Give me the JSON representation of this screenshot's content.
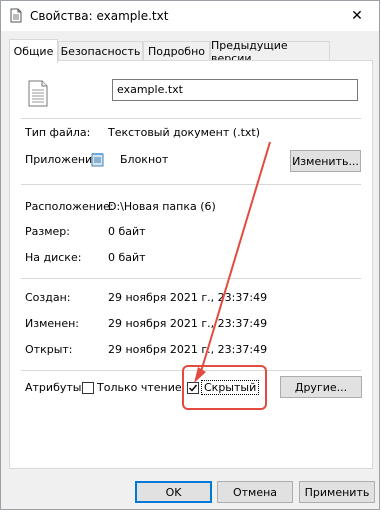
{
  "window": {
    "title": "Свойства: example.txt",
    "close_glyph": "✕"
  },
  "tabs": [
    {
      "label": "Общие",
      "active": true
    },
    {
      "label": "Безопасность",
      "active": false
    },
    {
      "label": "Подробно",
      "active": false
    },
    {
      "label": "Предыдущие версии",
      "active": false
    }
  ],
  "general": {
    "file_name": "example.txt",
    "file_type_label": "Тип файла:",
    "file_type_value": "Текстовый документ (.txt)",
    "app_label": "Приложение:",
    "app_value": "Блокнот",
    "change_button": "Изменить...",
    "location_label": "Расположение:",
    "location_value": "D:\\Новая папка (6)",
    "size_label": "Размер:",
    "size_value": "0 байт",
    "disk_label": "На диске:",
    "disk_value": "0 байт",
    "created_label": "Создан:",
    "created_value": "29 ноября 2021 г., 23:37:49",
    "modified_label": "Изменен:",
    "modified_value": "29 ноября 2021 г., 23:37:49",
    "opened_label": "Открыт:",
    "opened_value": "29 ноября 2021 г., 23:37:49",
    "attributes_label": "Атрибуты:",
    "readonly_label": "Только чтение",
    "readonly_checked": false,
    "hidden_label": "Скрытый",
    "hidden_checked": true,
    "other_button": "Другие..."
  },
  "footer": {
    "ok": "OK",
    "cancel": "Отмена",
    "apply": "Применить"
  },
  "annotation": {
    "color": "#e34b40"
  },
  "icons": {
    "title": "text-file-icon",
    "file": "text-document-icon",
    "app": "notepad-icon"
  }
}
